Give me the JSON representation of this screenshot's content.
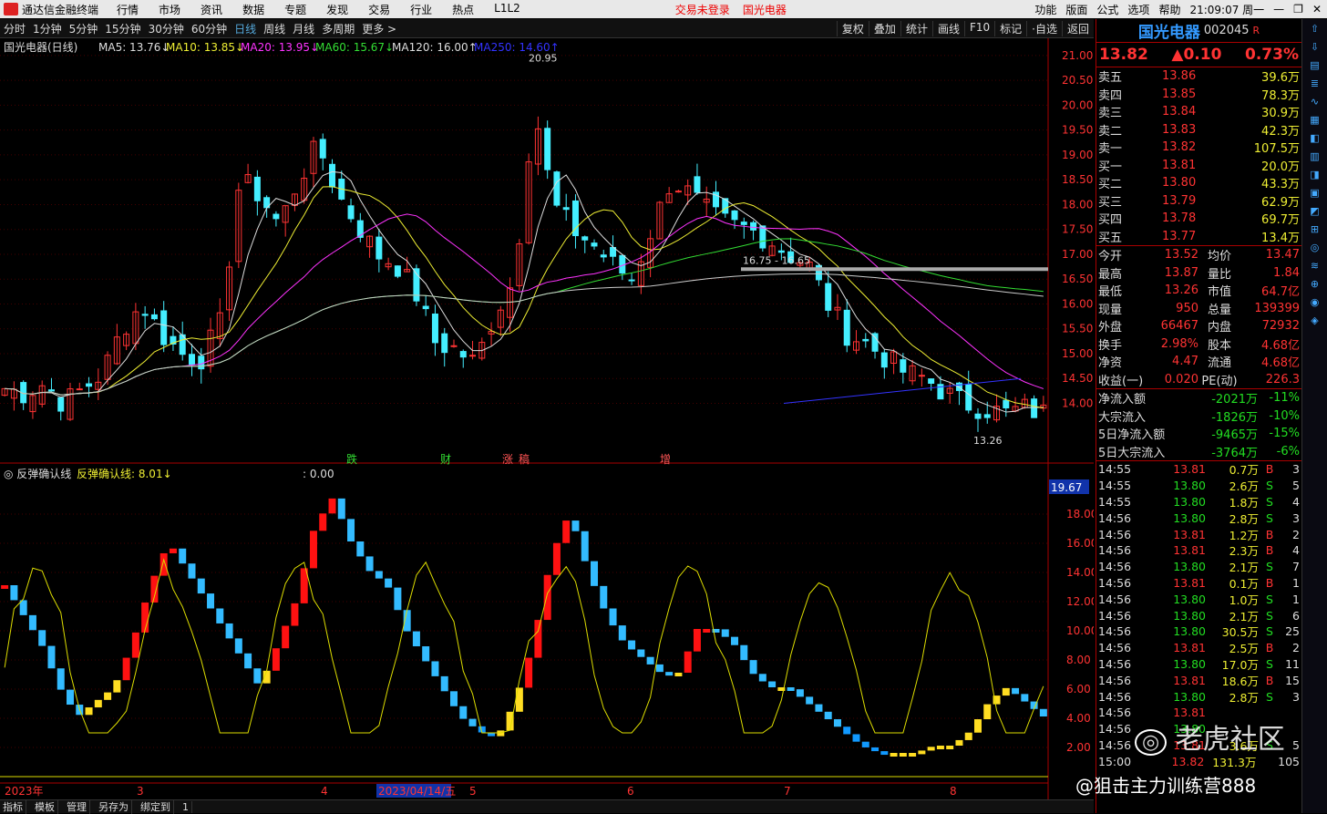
{
  "app": {
    "title": "通达信金融终端",
    "menu": [
      "行情",
      "市场",
      "资讯",
      "数据",
      "专题",
      "发现",
      "交易",
      "行业",
      "热点",
      "L1L2"
    ],
    "alert": "交易未登录",
    "stock": "国光电器",
    "right_menu": [
      "功能",
      "版面",
      "公式",
      "选项",
      "帮助"
    ],
    "time": "21:09:07 周一"
  },
  "tabs": [
    "分时",
    "1分钟",
    "5分钟",
    "15分钟",
    "30分钟",
    "60分钟",
    "日线",
    "周线",
    "月线",
    "多周期",
    "更多 >"
  ],
  "tools": [
    "复权",
    "叠加",
    "统计",
    "画线",
    "F10",
    "标记",
    "·自选",
    "返回"
  ],
  "ma": {
    "title": "国光电器(日线)",
    "ma5": "MA5: 13.76↓",
    "ma10": "MA10: 13.85↓",
    "ma20": "MA20: 13.95↓",
    "ma60": "MA60: 15.67↓",
    "ma120": "MA120: 16.00↑",
    "ma250": "MA250: 14.60↑"
  },
  "indicator": {
    "name": "反弹确认线",
    "value": "反弹确认线: 8.01↓",
    "extra": ": 0.00"
  },
  "price": {
    "name": "国光电器",
    "code": "002045",
    "sup": "R",
    "last": "13.82",
    "change": "▲0.10",
    "pct": "0.73%"
  },
  "book": [
    {
      "l": "卖五",
      "p": "13.86",
      "v": "39.6万"
    },
    {
      "l": "卖四",
      "p": "13.85",
      "v": "78.3万"
    },
    {
      "l": "卖三",
      "p": "13.84",
      "v": "30.9万"
    },
    {
      "l": "卖二",
      "p": "13.83",
      "v": "42.3万"
    },
    {
      "l": "卖一",
      "p": "13.82",
      "v": "107.5万"
    },
    {
      "l": "买一",
      "p": "13.81",
      "v": "20.0万"
    },
    {
      "l": "买二",
      "p": "13.80",
      "v": "43.3万"
    },
    {
      "l": "买三",
      "p": "13.79",
      "v": "62.9万"
    },
    {
      "l": "买四",
      "p": "13.78",
      "v": "69.7万"
    },
    {
      "l": "买五",
      "p": "13.77",
      "v": "13.4万"
    }
  ],
  "stats": [
    {
      "a": "今开",
      "b": "13.52",
      "c": "均价",
      "d": "13.47"
    },
    {
      "a": "最高",
      "b": "13.87",
      "c": "量比",
      "d": "1.84"
    },
    {
      "a": "最低",
      "b": "13.26",
      "c": "市值",
      "d": "64.7亿"
    },
    {
      "a": "现量",
      "b": "950",
      "c": "总量",
      "d": "139399"
    },
    {
      "a": "外盘",
      "b": "66467",
      "c": "内盘",
      "d": "72932"
    },
    {
      "a": "换手",
      "b": "2.98%",
      "c": "股本",
      "d": "4.68亿"
    },
    {
      "a": "净资",
      "b": "4.47",
      "c": "流通",
      "d": "4.68亿"
    },
    {
      "a": "收益(一)",
      "b": "0.020",
      "c": "PE(动)",
      "d": "226.3"
    }
  ],
  "flows": [
    {
      "a": "净流入额",
      "b": "-2021万",
      "c": "-11%"
    },
    {
      "a": "大宗流入",
      "b": "-1826万",
      "c": "-10%"
    },
    {
      "a": "5日净流入额",
      "b": "-9465万",
      "c": "-15%"
    },
    {
      "a": "5日大宗流入",
      "b": "-3764万",
      "c": "-6%"
    }
  ],
  "ticks": [
    [
      "14:55",
      "13.81",
      "0.7万",
      "B",
      "3"
    ],
    [
      "14:55",
      "13.80",
      "2.6万",
      "S",
      "5"
    ],
    [
      "14:55",
      "13.80",
      "1.8万",
      "S",
      "4"
    ],
    [
      "14:56",
      "13.80",
      "2.8万",
      "S",
      "3"
    ],
    [
      "14:56",
      "13.81",
      "1.2万",
      "B",
      "2"
    ],
    [
      "14:56",
      "13.81",
      "2.3万",
      "B",
      "4"
    ],
    [
      "14:56",
      "13.80",
      "2.1万",
      "S",
      "7"
    ],
    [
      "14:56",
      "13.81",
      "0.1万",
      "B",
      "1"
    ],
    [
      "14:56",
      "13.80",
      "1.0万",
      "S",
      "1"
    ],
    [
      "14:56",
      "13.80",
      "2.1万",
      "S",
      "6"
    ],
    [
      "14:56",
      "13.80",
      "30.5万",
      "S",
      "25"
    ],
    [
      "14:56",
      "13.81",
      "2.5万",
      "B",
      "2"
    ],
    [
      "14:56",
      "13.80",
      "17.0万",
      "S",
      "11"
    ],
    [
      "14:56",
      "13.81",
      "18.6万",
      "B",
      "15"
    ],
    [
      "14:56",
      "13.80",
      "2.8万",
      "S",
      "3"
    ],
    [
      "14:56",
      "13.81",
      "",
      "",
      ""
    ],
    [
      "14:56",
      "13.80",
      "",
      "",
      ""
    ],
    [
      "14:56",
      "13.81",
      "3.6万",
      "S",
      "5"
    ],
    [
      "15:00",
      "13.82",
      "131.3万",
      "",
      "105"
    ]
  ],
  "watermark": "老虎社区",
  "credit": "@狙击主力训练营888",
  "bottom": [
    "指标",
    "模板",
    "管理",
    "另存为",
    "绑定到",
    "1"
  ],
  "xlabels": [
    "2023年",
    "3",
    "4",
    "2023/04/14/五",
    "5",
    "6",
    "7",
    "8"
  ],
  "marks": [
    "跌",
    "财",
    "涨",
    "稿",
    "增"
  ],
  "hl": {
    "high": "20.95",
    "low": "13.26",
    "range": "16.75 - 16.65",
    "ind_top": "19.67"
  },
  "chart_data": [
    {
      "type": "candlestick",
      "ylim": [
        13.0,
        21.2
      ],
      "yticks": [
        14.0,
        14.5,
        15.0,
        15.5,
        16.0,
        16.5,
        17.0,
        17.5,
        18.0,
        18.5,
        19.0,
        19.5,
        20.0,
        20.5,
        21.0
      ]
    },
    {
      "type": "bar",
      "ylim": [
        0,
        20
      ],
      "yticks": [
        2.0,
        4.0,
        6.0,
        8.0,
        10.0,
        12.0,
        14.0,
        16.0,
        18.0
      ]
    }
  ]
}
